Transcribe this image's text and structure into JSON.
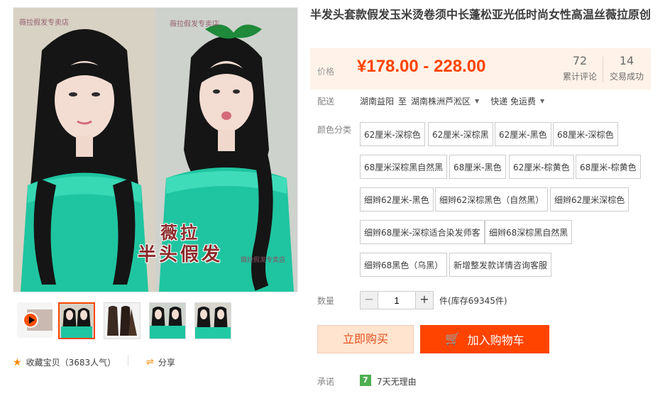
{
  "product": {
    "title": "半发头套款假发玉米烫卷须中长蓬松亚光低时尚女性高温丝薇拉原创"
  },
  "gallery": {
    "watermark": "薇拉假发专卖店",
    "brand_line1": "薇拉",
    "brand_line2": "半头假发",
    "thumbnails": [
      "video",
      "thumb-1",
      "thumb-2",
      "thumb-3",
      "thumb-4"
    ],
    "selected_thumbnail": 1,
    "favorite_label": "收藏宝贝（3683人气）",
    "share_label": "分享",
    "star_icon": "star-icon",
    "share_icon": "share-icon"
  },
  "price": {
    "label": "价格",
    "range": "¥178.00 - 228.00",
    "reviews_count": "72",
    "reviews_label": "累计评论",
    "trades_count": "14",
    "trades_label": "交易成功"
  },
  "shipping": {
    "label": "配送",
    "from": "湖南益阳",
    "to_word": "至",
    "destination": "湖南株洲芦淞区",
    "method": "快递 免运费"
  },
  "colors": {
    "label": "颜色分类",
    "options": [
      "62厘米-深棕色",
      "62厘米-深棕黑",
      "62厘米-黑色",
      "68厘米-深棕色",
      "68厘米深棕黑自然黑",
      "68厘米-黑色",
      "62厘米-棕黄色",
      "68厘米-棕黄色",
      "细辫62厘米-黑色",
      "细辫62深棕黑色（自然黑）",
      "细辫62厘米深棕色",
      "细辫68厘米-深棕适合染发师客",
      "细辫68深棕黑自然黑",
      "细辫68黑色（乌黑）",
      "新增整发款详情咨询客服"
    ]
  },
  "quantity": {
    "label": "数量",
    "value": "1",
    "minus": "−",
    "plus": "+",
    "stock": "件(库存69345件)"
  },
  "actions": {
    "buy_now": "立即购买",
    "add_to_cart": "加入购物车"
  },
  "promise": {
    "label": "承诺",
    "badge": "7",
    "text": "7天无理由"
  },
  "colors_theme": {
    "accent": "#ff4400",
    "price_bg": "#fff2e8"
  }
}
